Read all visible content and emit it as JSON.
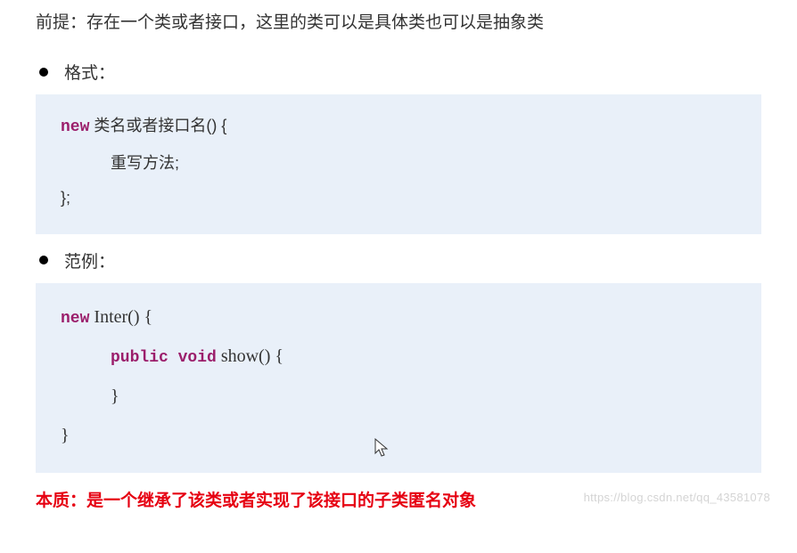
{
  "premise": "前提：存在一个类或者接口，这里的类可以是具体类也可以是抽象类",
  "sections": {
    "format": {
      "label": "格式：",
      "code": {
        "line1_kw": "new",
        "line1_rest": " 类名或者接口名() {",
        "line2": "重写方法;",
        "line3": "};"
      }
    },
    "example": {
      "label": "范例：",
      "code": {
        "line1_kw": "new",
        "line1_rest": " Inter() {",
        "line2_kw": "public void",
        "line2_rest": " show() {",
        "line3": "}",
        "line4": "}"
      }
    }
  },
  "essence": "本质：是一个继承了该类或者实现了该接口的子类匿名对象",
  "watermark": "https://blog.csdn.net/qq_43581078"
}
